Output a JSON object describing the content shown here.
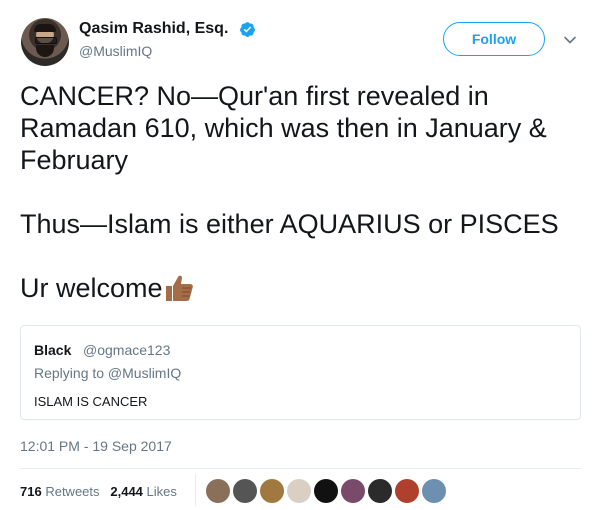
{
  "tweet": {
    "author_name": "Qasim Rashid, Esq.",
    "author_handle": "@MuslimIQ",
    "follow_label": "Follow",
    "text_lines": [
      "CANCER? No—Qur'an first revealed in Ramadan 610, which was then in January & February",
      "",
      "Thus—Islam is either AQUARIUS or PISCES",
      "",
      "Ur welcome"
    ],
    "emoji": "thumbs-up-medium-dark-skin-tone",
    "timestamp": "12:01 PM - 19 Sep 2017",
    "retweets_count": "716",
    "retweets_label": "Retweets",
    "likes_count": "2,444",
    "likes_label": "Likes"
  },
  "quoted": {
    "name": "Black",
    "handle": "@ogmace123",
    "replying_to": "Replying to @MuslimIQ",
    "text": "ISLAM IS CANCER"
  },
  "likers": [
    {
      "icon": "liker-avatar-1",
      "color": "#8a6f5a"
    },
    {
      "icon": "liker-avatar-2",
      "color": "#555555"
    },
    {
      "icon": "liker-avatar-3",
      "color": "#a07840"
    },
    {
      "icon": "liker-avatar-4",
      "color": "#d9cfc2"
    },
    {
      "icon": "liker-avatar-5",
      "color": "#111111"
    },
    {
      "icon": "liker-avatar-6",
      "color": "#7a4a6a"
    },
    {
      "icon": "liker-avatar-7",
      "color": "#2b2b2b"
    },
    {
      "icon": "liker-avatar-8",
      "color": "#b0402e"
    },
    {
      "icon": "liker-avatar-9",
      "color": "#6d8fb0"
    }
  ],
  "colors": {
    "accent": "#1da1f2",
    "secondary_text": "#657786",
    "primary_text": "#14171a",
    "emoji_skin": "#a46c47"
  }
}
